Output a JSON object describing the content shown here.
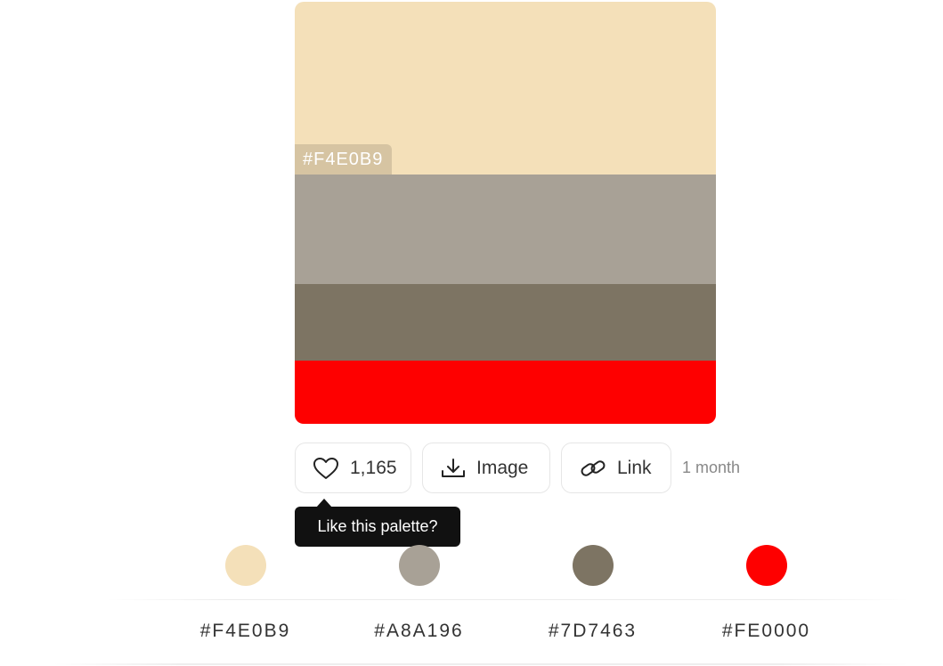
{
  "palette": {
    "swatches": [
      {
        "hex": "#F4E0B9",
        "color": "#F4E0B9"
      },
      {
        "hex": "#A8A196",
        "color": "#A8A196"
      },
      {
        "hex": "#7D7463",
        "color": "#7D7463"
      },
      {
        "hex": "#FE0000",
        "color": "#FE0000"
      }
    ],
    "hovered_label": "#F4E0B9"
  },
  "actions": {
    "like": {
      "icon": "heart-icon",
      "count": "1,165"
    },
    "image": {
      "icon": "download-icon",
      "label": "Image"
    },
    "link": {
      "icon": "link-icon",
      "label": "Link"
    },
    "time": "1 month"
  },
  "tooltip": {
    "text": "Like this palette?"
  },
  "colors": [
    {
      "hex": "#F4E0B9",
      "color": "#F4E0B9"
    },
    {
      "hex": "#A8A196",
      "color": "#A8A196"
    },
    {
      "hex": "#7D7463",
      "color": "#7D7463"
    },
    {
      "hex": "#FE0000",
      "color": "#FE0000"
    }
  ]
}
